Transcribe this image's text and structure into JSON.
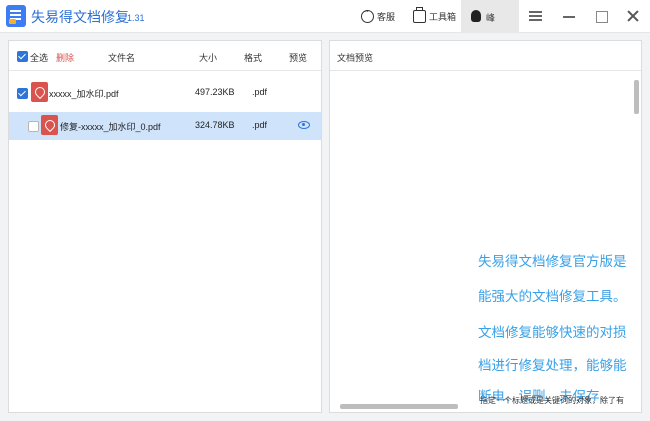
{
  "app": {
    "title": "失易得文档修复",
    "version": "1.31"
  },
  "toolbar": {
    "service_label": "客服",
    "toolbox_label": "工具箱",
    "user_name": "峰"
  },
  "file_list": {
    "select_all_label": "全选",
    "delete_label": "删除",
    "columns": {
      "name": "文件名",
      "size": "大小",
      "format": "格式",
      "preview": "预览"
    },
    "rows": [
      {
        "name": "xxxxx_加水印.pdf",
        "size": "497.23KB",
        "format": ".pdf"
      },
      {
        "name": "修复-xxxxx_加水印_0.pdf",
        "size": "324.78KB",
        "format": ".pdf"
      }
    ]
  },
  "preview": {
    "title": "文档预览",
    "lines": [
      "失易得文档修复官方版是",
      "能强大的文档修复工具。",
      "文档修复能够快速的对损",
      "档进行修复处理，能够能",
      "断电、误删、未保存、"
    ],
    "small_text": "指定一个标题或是关键词的对象，除了有"
  },
  "colors": {
    "accent": "#2f74d8",
    "preview_text": "#3aa0e6",
    "delete": "#d9534f"
  }
}
